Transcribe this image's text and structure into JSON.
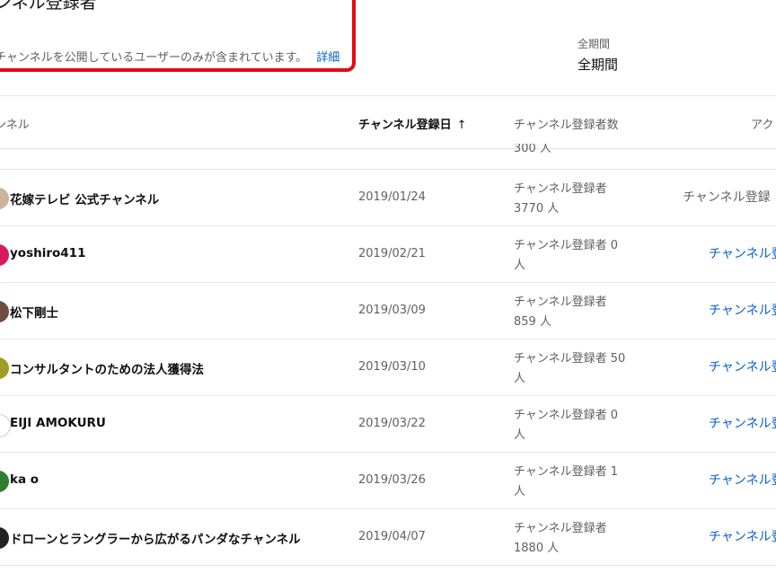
{
  "info_card": {
    "title": "ンネル登録者",
    "description": "チャンネルを公開しているユーザーのみが含まれています。",
    "link_label": "詳細"
  },
  "period": {
    "label": "全期間",
    "value": "全期間"
  },
  "table": {
    "headers": {
      "channel": "ンネル",
      "date": "チャンネル登録日",
      "date_sort_icon": "↑",
      "subscribers": "チャンネル登録者数",
      "action": "アク"
    },
    "partial_row_subscribers": "300 人",
    "rows": [
      {
        "name": "花嫁テレビ 公式チャンネル",
        "date": "2019/01/24",
        "subscribers": "チャンネル登録者 3770 人",
        "action": "チャンネル登録",
        "action_style": "plain",
        "avatar_color": "#c9b59a"
      },
      {
        "name": "yoshiro411",
        "date": "2019/02/21",
        "subscribers": "チャンネル登録者 0 人",
        "action": "チャンネル登",
        "action_style": "link",
        "avatar_color": "#d81b60"
      },
      {
        "name": "松下剛士",
        "date": "2019/03/09",
        "subscribers": "チャンネル登録者 859 人",
        "action": "チャンネル登",
        "action_style": "link",
        "avatar_color": "#6d4c41"
      },
      {
        "name": "コンサルタントのための法人獲得法",
        "date": "2019/03/10",
        "subscribers": "チャンネル登録者 50 人",
        "action": "チャンネル登",
        "action_style": "link",
        "avatar_color": "#9e9d24"
      },
      {
        "name": "EIJI AMOKURU",
        "date": "2019/03/22",
        "subscribers": "チャンネル登録者 0 人",
        "action": "チャンネル登",
        "action_style": "link",
        "avatar_color": "#ffffff"
      },
      {
        "name": "ka o",
        "date": "2019/03/26",
        "subscribers": "チャンネル登録者 1 人",
        "action": "チャンネル登",
        "action_style": "link",
        "avatar_color": "#2e7d32"
      },
      {
        "name": "ドローンとラングラーから広がるパンダなチャンネル",
        "date": "2019/04/07",
        "subscribers": "チャンネル登録者 1880 人",
        "action": "チャンネル登",
        "action_style": "link",
        "avatar_color": "#212121"
      }
    ]
  }
}
